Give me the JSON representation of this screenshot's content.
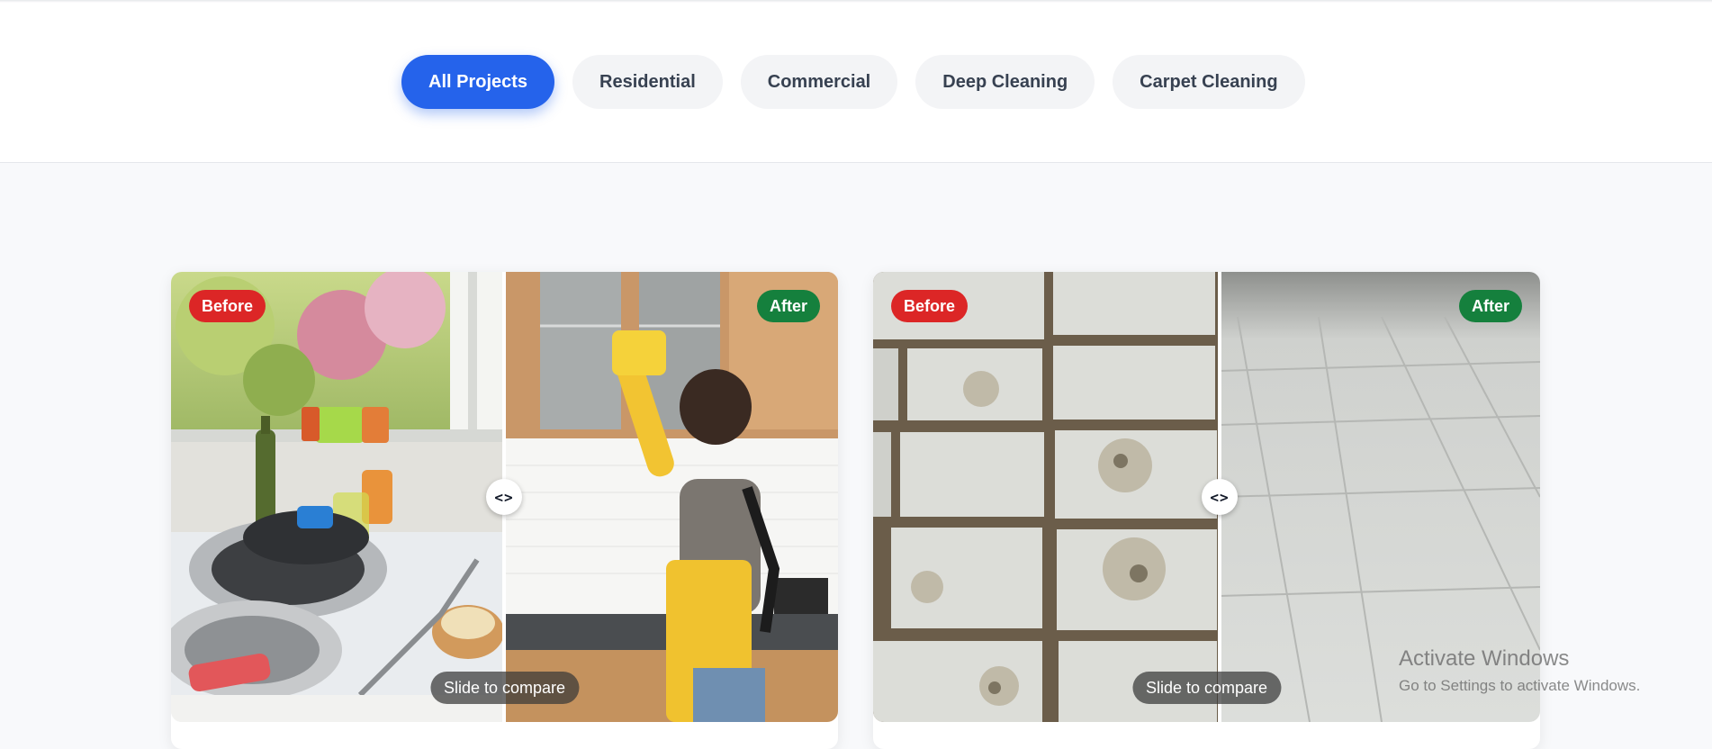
{
  "filters": {
    "items": [
      {
        "label": "All Projects",
        "active": true
      },
      {
        "label": "Residential",
        "active": false
      },
      {
        "label": "Commercial",
        "active": false
      },
      {
        "label": "Deep Cleaning",
        "active": false
      },
      {
        "label": "Carpet Cleaning",
        "active": false
      }
    ]
  },
  "projects": [
    {
      "before_label": "Before",
      "after_label": "After",
      "compare_hint": "Slide to compare",
      "handle_icon": "arrows-left-right-icon",
      "before_image": "messy-kitchen-sink-with-dishes",
      "after_image": "woman-cleaning-kitchen-cabinets"
    },
    {
      "before_label": "Before",
      "after_label": "After",
      "compare_hint": "Slide to compare",
      "handle_icon": "arrows-left-right-icon",
      "before_image": "dirty-stained-floor-tiles",
      "after_image": "clean-white-floor-tiles"
    }
  ],
  "watermark": {
    "title": "Activate Windows",
    "subtitle": "Go to Settings to activate Windows."
  },
  "colors": {
    "accent": "#2563eb",
    "before_badge": "#dc2626",
    "after_badge": "#15803d"
  }
}
